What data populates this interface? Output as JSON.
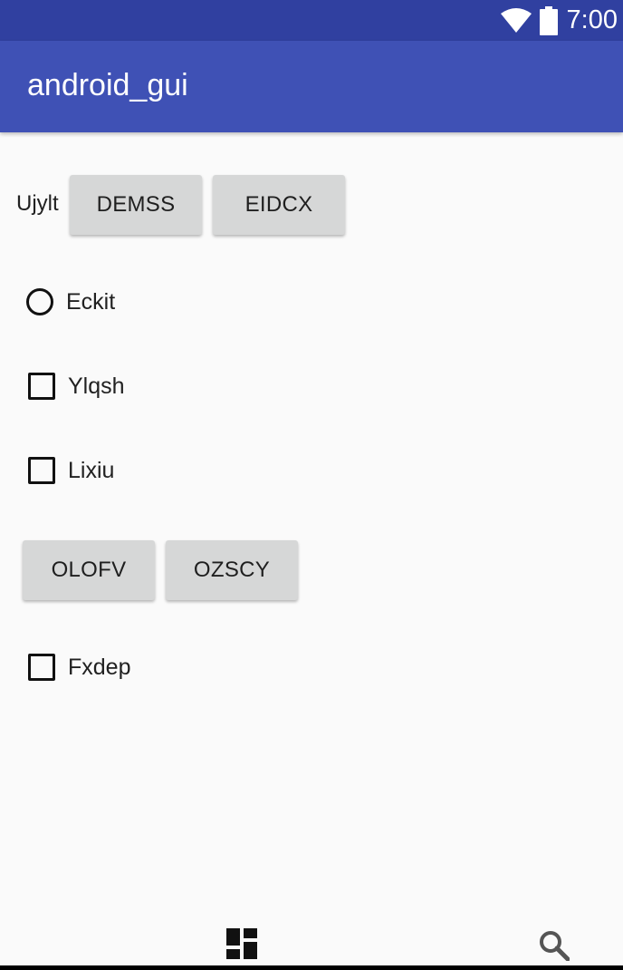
{
  "status_bar": {
    "time": "7:00",
    "icons": [
      "wifi-icon",
      "battery-icon"
    ]
  },
  "app_bar": {
    "title": "android_gui"
  },
  "content": {
    "label_1": "Ujylt",
    "button_1": "DEMSS",
    "button_2": "EIDCX",
    "radio_1": {
      "label": "Eckit",
      "checked": false
    },
    "checkbox_1": {
      "label": "Ylqsh",
      "checked": false
    },
    "checkbox_2": {
      "label": "Lixiu",
      "checked": false
    },
    "button_3": "OLOFV",
    "button_4": "OZSCY",
    "checkbox_3": {
      "label": "Fxdep",
      "checked": false
    }
  },
  "bottom_nav": {
    "icons": [
      "dashboard-icon",
      "search-icon"
    ]
  },
  "colors": {
    "status_bar": "#3040a0",
    "app_bar": "#3f51b5",
    "background": "#fafafa",
    "button": "#d6d7d7"
  }
}
